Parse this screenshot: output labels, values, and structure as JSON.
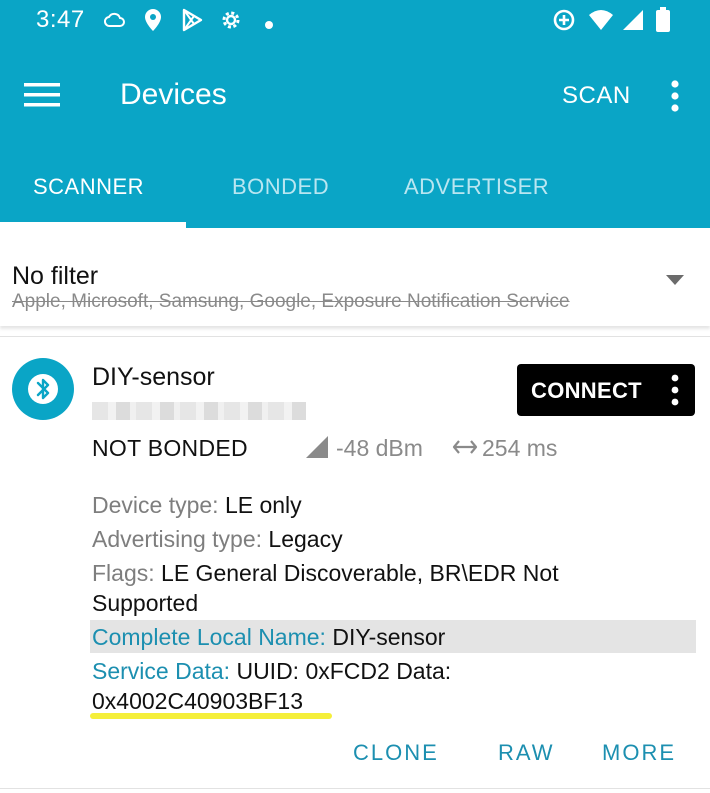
{
  "status_bar": {
    "time": "3:47",
    "left_icons": [
      "cloud-icon",
      "location-icon",
      "play-store-icon",
      "settings-gear-icon",
      "dot-icon"
    ],
    "right_icons": [
      "data-saver-icon",
      "wifi-icon",
      "signal-icon",
      "battery-icon"
    ]
  },
  "app_bar": {
    "title": "Devices",
    "scan_label": "SCAN",
    "colors": {
      "primary": "#0aa5c6",
      "accent": "#1c8fb0"
    }
  },
  "tabs": [
    {
      "label": "SCANNER",
      "active": true
    },
    {
      "label": "BONDED",
      "active": false
    },
    {
      "label": "ADVERTISER",
      "active": false
    }
  ],
  "filter": {
    "title": "No filter",
    "excluded": "Apple, Microsoft, Samsung, Google, Exposure Notification Service"
  },
  "device": {
    "name": "DIY-sensor",
    "bond_state": "NOT BONDED",
    "rssi": "-48 dBm",
    "interval": "254 ms",
    "connect_label": "CONNECT",
    "details": {
      "device_type_label": "Device type:",
      "device_type_value": "LE only",
      "adv_type_label": "Advertising type:",
      "adv_type_value": "Legacy",
      "flags_label": "Flags:",
      "flags_value_line1": "LE General Discoverable, BR\\EDR Not",
      "flags_value_line2": "Supported",
      "local_name_label": "Complete Local Name:",
      "local_name_value": "DIY-sensor",
      "service_data_label": "Service Data:",
      "service_data_value_line1": "UUID: 0xFCD2 Data:",
      "service_data_value_line2": "0x4002C40903BF13"
    },
    "actions": {
      "clone": "CLONE",
      "raw": "RAW",
      "more": "MORE"
    }
  }
}
